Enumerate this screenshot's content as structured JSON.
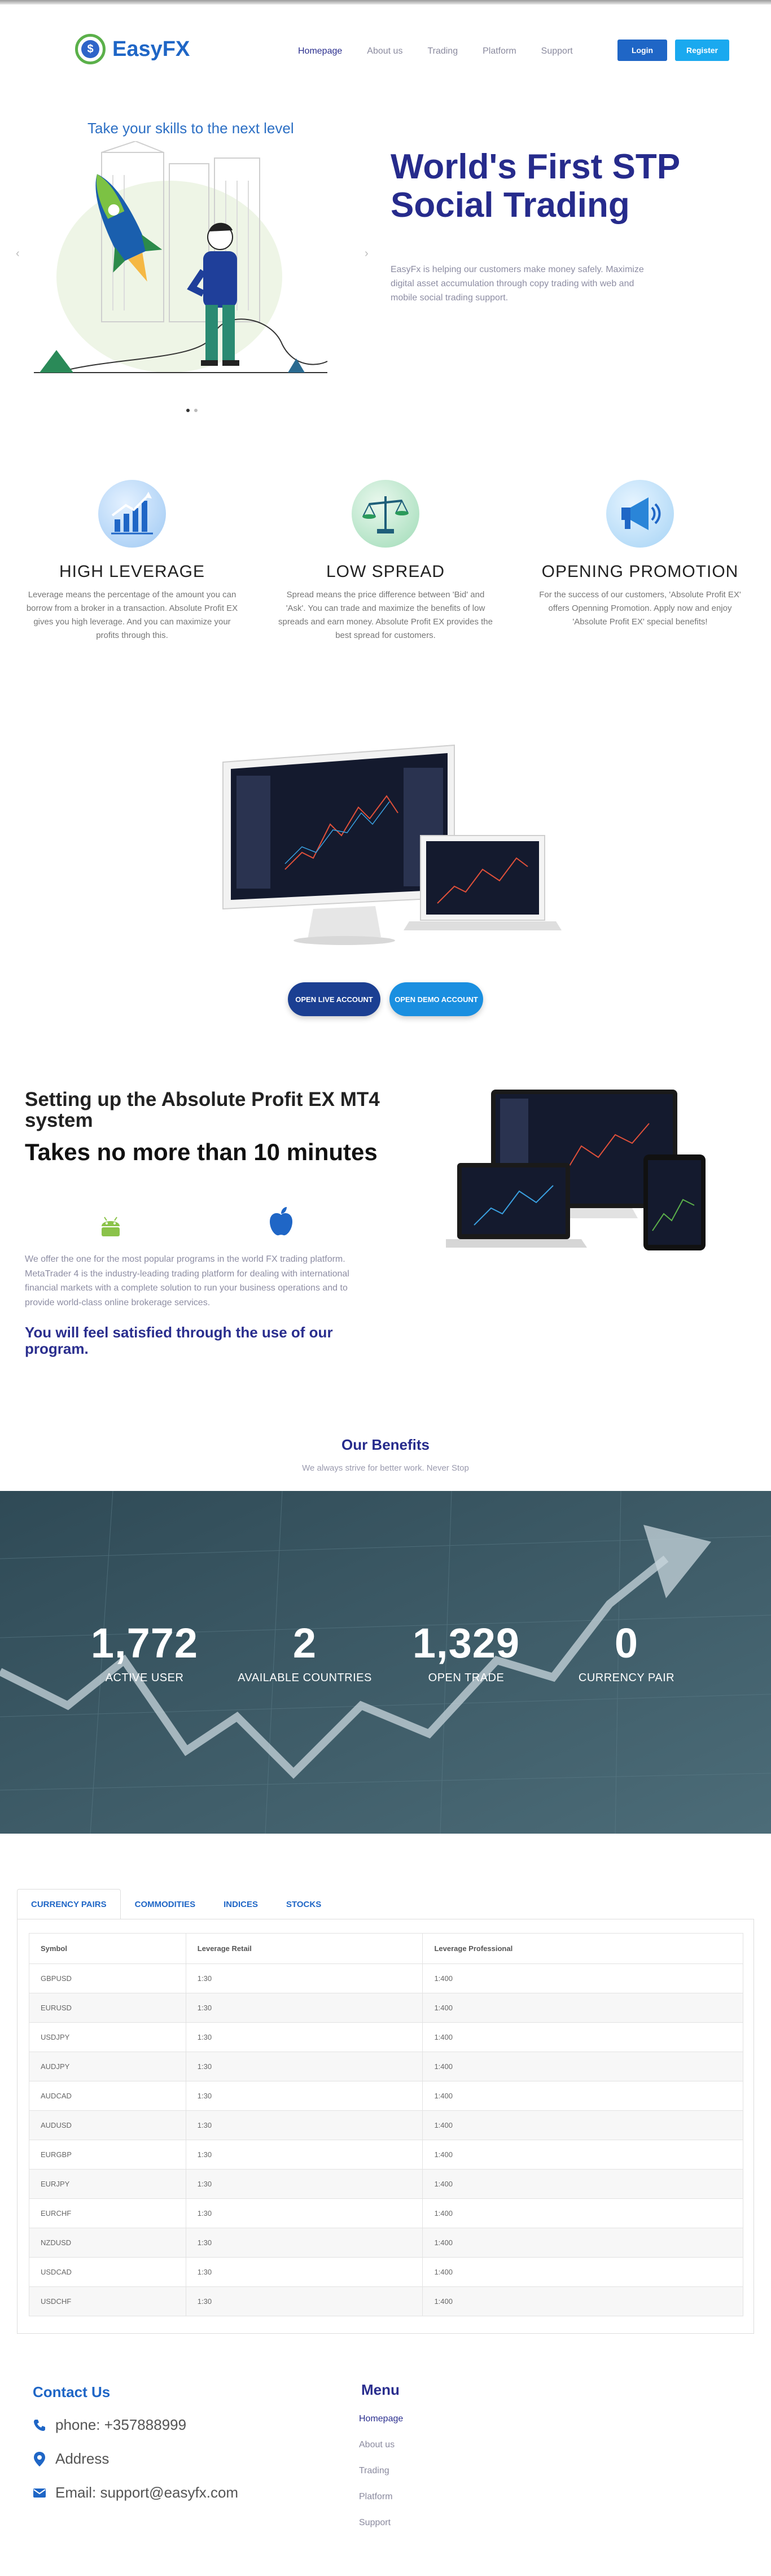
{
  "brand": {
    "name": "EasyFX",
    "accent": "#1f66c6",
    "green": "#5bb04a",
    "navy": "#262b8c"
  },
  "nav": {
    "items": [
      {
        "label": "Homepage",
        "active": true
      },
      {
        "label": "About us"
      },
      {
        "label": "Trading"
      },
      {
        "label": "Platform"
      },
      {
        "label": "Support"
      }
    ],
    "login": "Login",
    "register": "Register"
  },
  "hero": {
    "tagline": "Take your skills to the next level",
    "title": "World's First STP Social Trading",
    "description": "EasyFx is helping our customers make money safely. Maximize digital asset accumulation through copy trading with web and mobile social trading support.",
    "slides_total": 2,
    "slide_active": 1
  },
  "features": [
    {
      "icon": "chart-growth-icon",
      "title": "HIGH LEVERAGE",
      "text": "Leverage means the percentage of the amount you can borrow from a broker in a transaction. Absolute Profit EX gives you high leverage. And you can maximize your profits through this."
    },
    {
      "icon": "scale-balance-icon",
      "title": "LOW SPREAD",
      "text": "Spread means the price difference between 'Bid' and 'Ask'. You can trade and maximize the benefits of low spreads and earn money. Absolute Profit EX provides the best spread for customers."
    },
    {
      "icon": "megaphone-icon",
      "title": "OPENING PROMOTION",
      "text": "For the success of our customers, 'Absolute Profit EX' offers Openning Promotion. Apply now and enjoy 'Absolute Profit EX' special benefits!"
    }
  ],
  "platform": {
    "open_live": "OPEN LIVE ACCOUNT",
    "open_demo": "OPEN DEMO ACCOUNT"
  },
  "mt4": {
    "title": "Setting up the Absolute Profit EX MT4 system",
    "subtitle": "Takes no more than 10 minutes",
    "description": "We offer the one for the most popular programs in the world FX trading platform. MetaTrader 4 is the industry-leading trading platform for dealing with international financial markets with a complete solution to run your business operations and to provide world-class online brokerage services.",
    "satisfied": "You will feel satisfied through the use of our program."
  },
  "benefits": {
    "title": "Our Benefits",
    "subtitle": "We always strive for better work. Never Stop",
    "stats": [
      {
        "value": "1,772",
        "label": "ACTIVE USER"
      },
      {
        "value": "2",
        "label": "AVAILABLE COUNTRIES"
      },
      {
        "value": "1,329",
        "label": "OPEN TRADE"
      },
      {
        "value": "0",
        "label": "CURRENCY PAIR"
      }
    ]
  },
  "tabs": [
    {
      "label": "CURRENCY PAIRS",
      "active": true
    },
    {
      "label": "COMMODITIES"
    },
    {
      "label": "INDICES"
    },
    {
      "label": "STOCKS"
    }
  ],
  "table": {
    "headers": [
      "Symbol",
      "Leverage Retail",
      "Leverage Professional"
    ],
    "rows": [
      [
        "GBPUSD",
        "1:30",
        "1:400"
      ],
      [
        "EURUSD",
        "1:30",
        "1:400"
      ],
      [
        "USDJPY",
        "1:30",
        "1:400"
      ],
      [
        "AUDJPY",
        "1:30",
        "1:400"
      ],
      [
        "AUDCAD",
        "1:30",
        "1:400"
      ],
      [
        "AUDUSD",
        "1:30",
        "1:400"
      ],
      [
        "EURGBP",
        "1:30",
        "1:400"
      ],
      [
        "EURJPY",
        "1:30",
        "1:400"
      ],
      [
        "EURCHF",
        "1:30",
        "1:400"
      ],
      [
        "NZDUSD",
        "1:30",
        "1:400"
      ],
      [
        "USDCAD",
        "1:30",
        "1:400"
      ],
      [
        "USDCHF",
        "1:30",
        "1:400"
      ]
    ]
  },
  "footer": {
    "contact_title": "Contact Us",
    "phone": "phone: +357888999",
    "address": "Address",
    "email": "Email: support@easyfx.com",
    "menu_title": "Menu",
    "menu": [
      "Homepage",
      "About us",
      "Trading",
      "Platform",
      "Support"
    ]
  }
}
